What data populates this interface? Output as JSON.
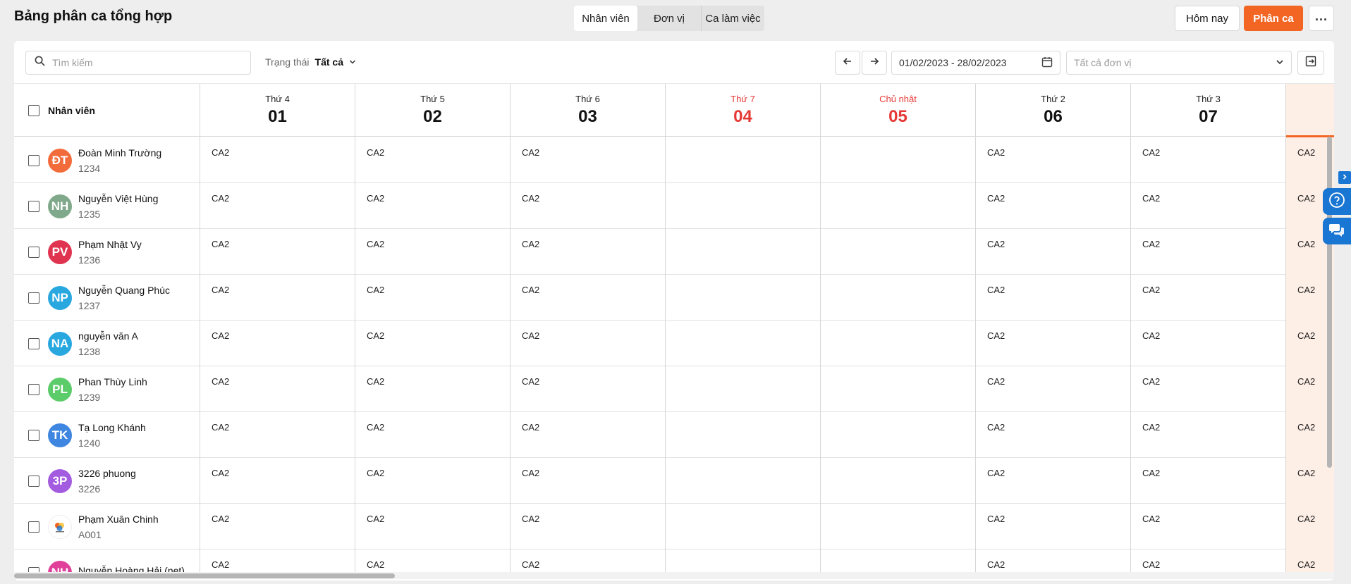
{
  "header": {
    "title": "Bảng phân ca tổng hợp",
    "tabs": [
      "Nhân viên",
      "Đơn vị",
      "Ca làm việc"
    ],
    "today_label": "Hôm nay",
    "assign_label": "Phân ca",
    "more_label": "..."
  },
  "toolbar": {
    "search_placeholder": "Tìm kiếm",
    "status_label": "Trạng thái",
    "status_value": "Tất cả",
    "date_range": "01/02/2023 - 28/02/2023",
    "unit_placeholder": "Tất cả đơn vị"
  },
  "grid": {
    "employee_header": "Nhân viên",
    "days": [
      {
        "weekday": "Thứ 4",
        "day": "01"
      },
      {
        "weekday": "Thứ 5",
        "day": "02"
      },
      {
        "weekday": "Thứ 6",
        "day": "03"
      },
      {
        "weekday": "Thứ 7",
        "day": "04"
      },
      {
        "weekday": "Chủ nhật",
        "day": "05"
      },
      {
        "weekday": "Thứ 2",
        "day": "06"
      },
      {
        "weekday": "Thứ 3",
        "day": "07"
      },
      {
        "weekday": "",
        "day": ""
      }
    ],
    "employees": [
      {
        "initials": "ĐT",
        "color": "#f26b3a",
        "name": "Đoàn Minh Trường",
        "code": "1234",
        "shifts": [
          "CA2",
          "CA2",
          "CA2",
          "",
          "",
          "CA2",
          "CA2",
          "CA2"
        ]
      },
      {
        "initials": "NH",
        "color": "#7fa98a",
        "name": "Nguyễn Việt Hùng",
        "code": "1235",
        "shifts": [
          "CA2",
          "CA2",
          "CA2",
          "",
          "",
          "CA2",
          "CA2",
          "CA2"
        ]
      },
      {
        "initials": "PV",
        "color": "#e0334f",
        "name": "Phạm Nhật Vy",
        "code": "1236",
        "shifts": [
          "CA2",
          "CA2",
          "CA2",
          "",
          "",
          "CA2",
          "CA2",
          "CA2"
        ]
      },
      {
        "initials": "NP",
        "color": "#29a8e0",
        "name": "Nguyễn Quang Phúc",
        "code": "1237",
        "shifts": [
          "CA2",
          "CA2",
          "CA2",
          "",
          "",
          "CA2",
          "CA2",
          "CA2"
        ]
      },
      {
        "initials": "NA",
        "color": "#29a8e0",
        "name": "nguyễn văn A",
        "code": "1238",
        "shifts": [
          "CA2",
          "CA2",
          "CA2",
          "",
          "",
          "CA2",
          "CA2",
          "CA2"
        ]
      },
      {
        "initials": "PL",
        "color": "#5ccc6a",
        "name": "Phan Thùy Linh",
        "code": "1239",
        "shifts": [
          "CA2",
          "CA2",
          "CA2",
          "",
          "",
          "CA2",
          "CA2",
          "CA2"
        ]
      },
      {
        "initials": "TK",
        "color": "#3f86e0",
        "name": "Tạ Long Khánh",
        "code": "1240",
        "shifts": [
          "CA2",
          "CA2",
          "CA2",
          "",
          "",
          "CA2",
          "CA2",
          "CA2"
        ]
      },
      {
        "initials": "3P",
        "color": "#a35be0",
        "name": "3226 phuong",
        "code": "3226",
        "shifts": [
          "CA2",
          "CA2",
          "CA2",
          "",
          "",
          "CA2",
          "CA2",
          "CA2"
        ]
      },
      {
        "initials": "",
        "color": "#ffffff",
        "name": "Phạm Xuân Chinh",
        "code": "A001",
        "shifts": [
          "CA2",
          "CA2",
          "CA2",
          "",
          "",
          "CA2",
          "CA2",
          "CA2"
        ]
      },
      {
        "initials": "NH",
        "color": "#e0409a",
        "name": "Nguyễn Hoàng Hải (net)",
        "code": "",
        "shifts": [
          "CA2",
          "CA2",
          "CA2",
          "",
          "",
          "CA2",
          "CA2",
          "CA2"
        ]
      }
    ]
  },
  "colors": {
    "accent": "#f26522",
    "weekend": "#e53935",
    "today_bg": "#fdeee6",
    "widget": "#1976d2"
  }
}
